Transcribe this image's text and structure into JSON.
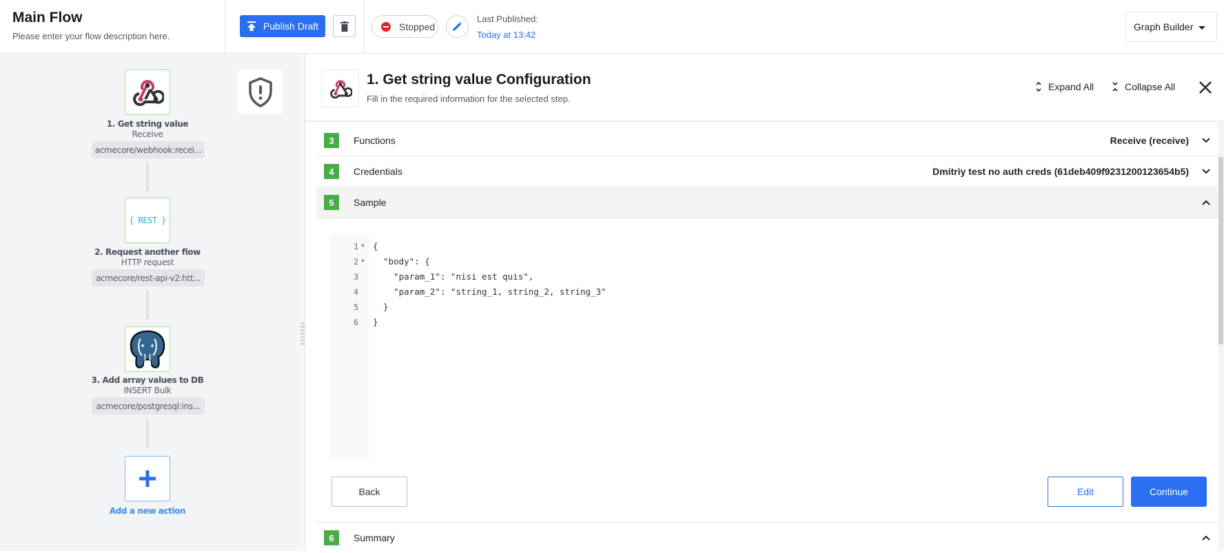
{
  "header": {
    "title": "Main Flow",
    "description": "Please enter your flow description here.",
    "publish_label": "Publish Draft",
    "status_label": "Stopped",
    "last_published_label": "Last Published:",
    "last_published_value": "Today at 13:42",
    "view_selector_label": "Graph Builder",
    "icons": {
      "publish": "upload-icon",
      "delete": "trash-icon",
      "status": "stop-icon",
      "edit": "pencil-icon",
      "selector": "caret-down-icon"
    }
  },
  "flow": {
    "nodes": [
      {
        "title": "1. Get string value",
        "subtitle": "Receive",
        "tag": "acmecore/webhook:recei...",
        "icon": "webhook-icon"
      },
      {
        "title": "2. Request another flow",
        "subtitle": "HTTP request",
        "tag": "acmecore/rest-api-v2:htt...",
        "icon": "rest-icon",
        "icon_text": "{ REST }"
      },
      {
        "title": "3. Add array values to DB",
        "subtitle": "INSERT Bulk",
        "tag": "acmecore/postgresql:ins...",
        "icon": "postgresql-icon"
      }
    ],
    "add_action_label": "Add a new action",
    "side_icon": "shield-alert-icon"
  },
  "config": {
    "title": "1. Get string value Configuration",
    "subtitle": "Fill in the required information for the selected step.",
    "expand_all_label": "Expand All",
    "collapse_all_label": "Collapse All",
    "sections": [
      {
        "number": "3",
        "label": "Functions",
        "value": "Receive (receive)",
        "expanded": false
      },
      {
        "number": "4",
        "label": "Credentials",
        "value": "Dmitriy test no auth creds (61deb409f9231200123654b5)",
        "expanded": false
      },
      {
        "number": "5",
        "label": "Sample",
        "value": "",
        "expanded": true
      },
      {
        "number": "6",
        "label": "Summary",
        "value": "",
        "expanded": true
      }
    ],
    "sample_code": [
      {
        "num": "1",
        "text": "{",
        "fold": true
      },
      {
        "num": "2",
        "text": "  \"body\": {",
        "fold": true
      },
      {
        "num": "3",
        "text": "    \"param_1\": \"nisi est quis\",",
        "fold": false
      },
      {
        "num": "4",
        "text": "    \"param_2\": \"string_1, string_2, string_3\"",
        "fold": false
      },
      {
        "num": "5",
        "text": "  }",
        "fold": false
      },
      {
        "num": "6",
        "text": "}",
        "fold": false
      }
    ],
    "back_label": "Back",
    "edit_label": "Edit",
    "continue_label": "Continue"
  },
  "colors": {
    "primary": "#2a6ff0",
    "success": "#48ad48",
    "danger": "#e02424",
    "webhook_pink": "#c73a63"
  }
}
